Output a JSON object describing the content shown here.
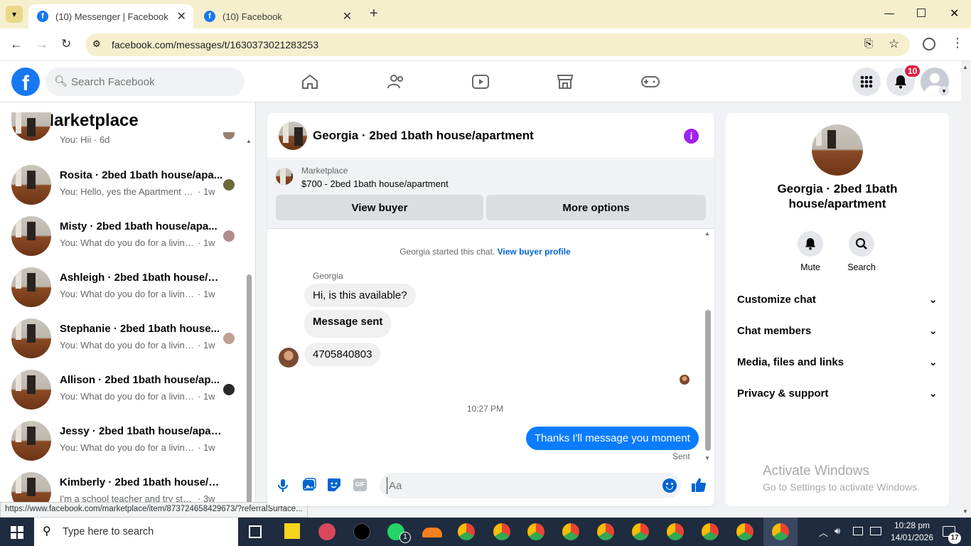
{
  "browser": {
    "tabs": [
      {
        "title": "(10) Messenger | Facebook",
        "active": true
      },
      {
        "title": "(10) Facebook",
        "active": false
      }
    ],
    "new_tab_label": "+",
    "url": "facebook.com/messages/t/1630373021283253"
  },
  "fb": {
    "search_placeholder": "Search Facebook",
    "notification_count": "10"
  },
  "left": {
    "title": "Marketplace",
    "conversations": [
      {
        "name": "",
        "preview": "You: Hii",
        "time": "· 6d"
      },
      {
        "name": "Rosita · 2bed 1bath house/apa...",
        "preview": "You: Hello, yes the Apartment is ...",
        "time": "· 1w"
      },
      {
        "name": "Misty · 2bed 1bath house/apa...",
        "preview": "You: What do you do for a living....",
        "time": "· 1w"
      },
      {
        "name": "Ashleigh · 2bed 1bath house/ap...",
        "preview": "You: What do you do for a living? ...",
        "time": "· 1w"
      },
      {
        "name": "Stephanie · 2bed 1bath house...",
        "preview": "You: What do you do for a living....",
        "time": "· 1w"
      },
      {
        "name": "Allison · 2bed 1bath house/ap...",
        "preview": "You: What do you do for a living....",
        "time": "· 1w"
      },
      {
        "name": "Jessy · 2bed 1bath house/apart...",
        "preview": "You: What do you do for a living? ...",
        "time": "· 1w"
      },
      {
        "name": "Kimberly · 2bed 1bath house/ap...",
        "preview": "I'm a school teacher and try stay in...",
        "time": "· 3w"
      }
    ]
  },
  "chat": {
    "title": "Georgia · 2bed 1bath house/apartment",
    "listing_source": "Marketplace",
    "listing_title": "$700 - 2bed 1bath house/apartment",
    "view_buyer": "View buyer",
    "more_options": "More options",
    "started_text": "Georgia started this chat.",
    "view_profile": "View buyer profile",
    "sender_name": "Georgia",
    "messages_in": [
      "Hi, is this available?",
      "Message sent",
      "4705840803"
    ],
    "timestamp": "10:27 PM",
    "message_out": "Thanks I'll message you moment",
    "sent_status": "Sent",
    "composer_placeholder": "Aa",
    "gif_label": "GIF"
  },
  "right": {
    "name": "Georgia · 2bed 1bath house/apartment",
    "mute": "Mute",
    "search": "Search",
    "sections": [
      "Customize chat",
      "Chat members",
      "Media, files and links",
      "Privacy & support"
    ],
    "watermark_title": "Activate Windows",
    "watermark_sub": "Go to Settings to activate Windows."
  },
  "status_url": "https://www.facebook.com/marketplace/item/873724658429673/?referralSurface...",
  "taskbar": {
    "search_placeholder": "Type here to search",
    "time": "10:28 pm",
    "date": "14/01/2026",
    "notif_count": "17",
    "whatsapp_badge": "1"
  },
  "colors": {
    "brand": "#1877f2",
    "outgoing": "#0a7cff",
    "taskbar": "#1f2b3e",
    "tabbar": "#f6efce"
  }
}
